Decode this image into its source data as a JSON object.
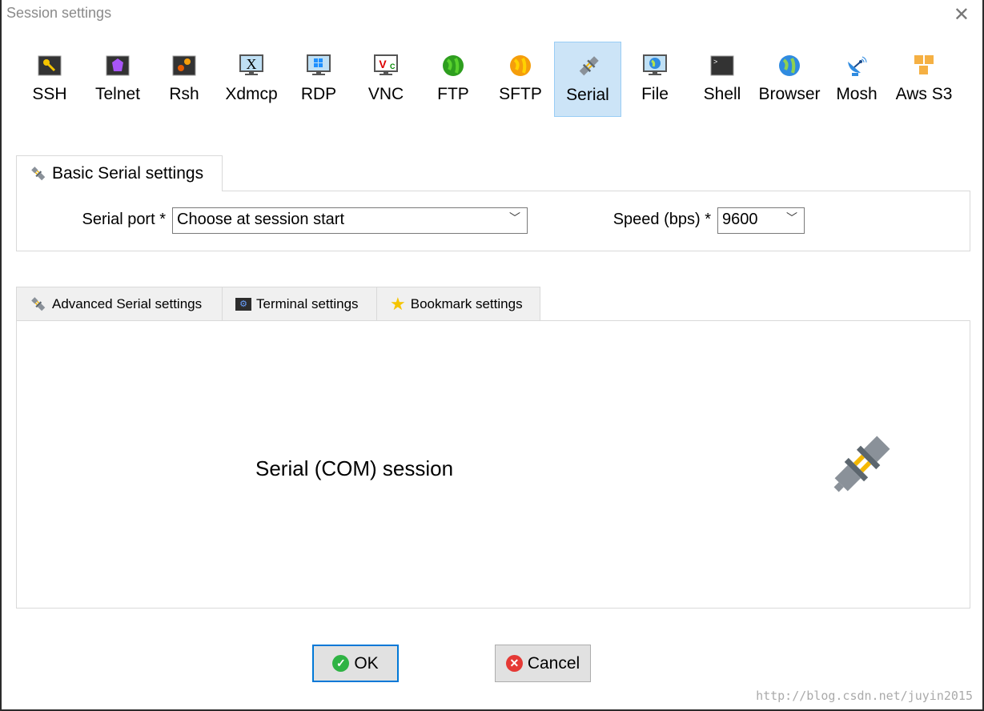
{
  "window": {
    "title": "Session settings",
    "close_icon": "close-icon"
  },
  "session_types": [
    {
      "label": "SSH",
      "icon": "key-icon"
    },
    {
      "label": "Telnet",
      "icon": "gem-icon"
    },
    {
      "label": "Rsh",
      "icon": "gears-icon"
    },
    {
      "label": "Xdmcp",
      "icon": "x-monitor-icon"
    },
    {
      "label": "RDP",
      "icon": "windows-monitor-icon"
    },
    {
      "label": "VNC",
      "icon": "vnc-monitor-icon"
    },
    {
      "label": "FTP",
      "icon": "green-globe-icon"
    },
    {
      "label": "SFTP",
      "icon": "orange-globe-icon"
    },
    {
      "label": "Serial",
      "icon": "plug-icon"
    },
    {
      "label": "File",
      "icon": "globe-monitor-icon"
    },
    {
      "label": "Shell",
      "icon": "terminal-icon"
    },
    {
      "label": "Browser",
      "icon": "globe-icon"
    },
    {
      "label": "Mosh",
      "icon": "satellite-icon"
    },
    {
      "label": "Aws S3",
      "icon": "cubes-icon"
    }
  ],
  "selected_type": "Serial",
  "basic": {
    "tab_label": "Basic Serial settings",
    "port_label": "Serial port *",
    "port_value": "Choose at session start",
    "speed_label": "Speed (bps) *",
    "speed_value": "9600"
  },
  "sub_tabs": [
    {
      "label": "Advanced Serial settings"
    },
    {
      "label": "Terminal settings"
    },
    {
      "label": "Bookmark settings"
    }
  ],
  "panel_text": "Serial (COM) session",
  "buttons": {
    "ok": "OK",
    "cancel": "Cancel"
  },
  "watermark": "http://blog.csdn.net/juyin2015"
}
